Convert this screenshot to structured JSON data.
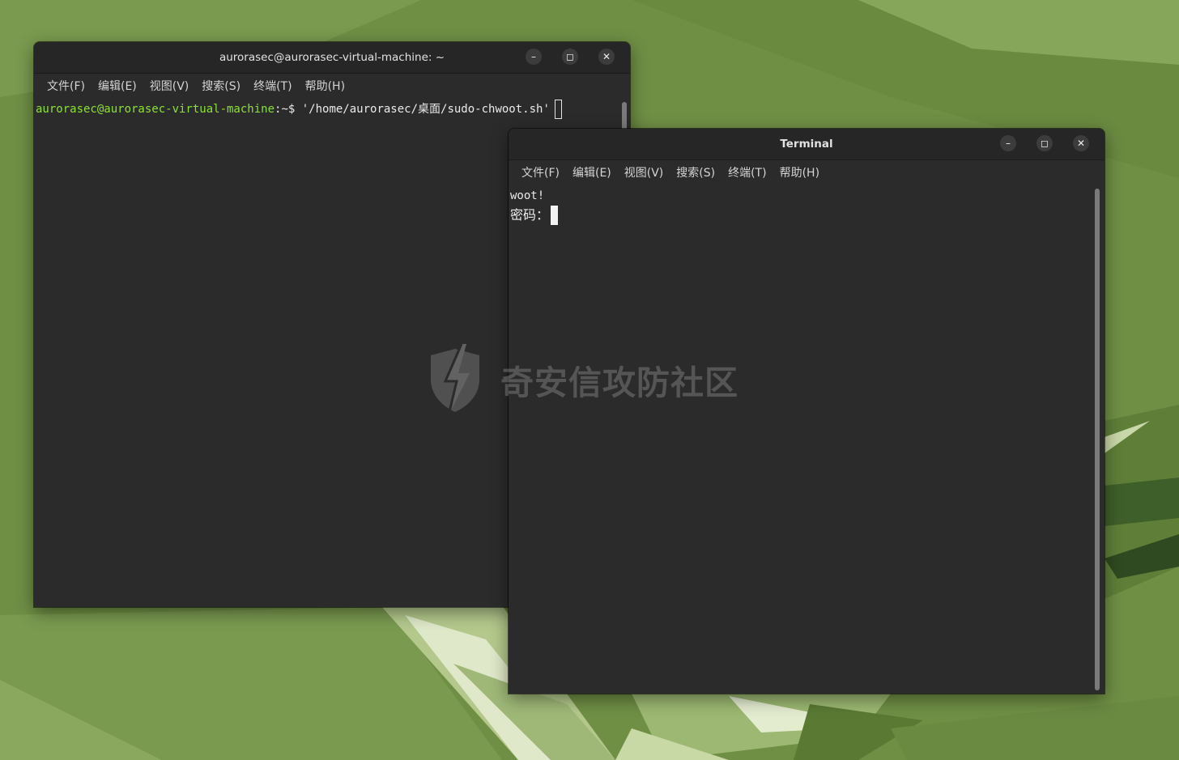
{
  "colors": {
    "wallpaper_base": "#6f8f45",
    "terminal_bg": "#2b2b2b",
    "titlebar_bg": "#262626",
    "prompt_user_host": "#8ae234",
    "text": "#eaeaea"
  },
  "window_back": {
    "title": "aurorasec@aurorasec-virtual-machine: ~",
    "controls": {
      "minimize_icon": "minimize-icon",
      "maximize_icon": "maximize-icon",
      "close_icon": "close-icon"
    },
    "menu": [
      "文件(F)",
      "编辑(E)",
      "视图(V)",
      "搜索(S)",
      "终端(T)",
      "帮助(H)"
    ],
    "prompt_user_host": "aurorasec@aurorasec-virtual-machine",
    "prompt_suffix": ":~$ ",
    "command": "'/home/aurorasec/桌面/sudo-chwoot.sh'"
  },
  "window_front": {
    "title": "Terminal",
    "controls": {
      "minimize_icon": "minimize-icon",
      "maximize_icon": "maximize-icon",
      "close_icon": "close-icon"
    },
    "menu": [
      "文件(F)",
      "编辑(E)",
      "视图(V)",
      "搜索(S)",
      "终端(T)",
      "帮助(H)"
    ],
    "output_line1": "woot!",
    "password_prompt": "密码："
  },
  "watermark": {
    "text": "奇安信攻防社区",
    "logo_icon": "shield-lightning-icon"
  }
}
